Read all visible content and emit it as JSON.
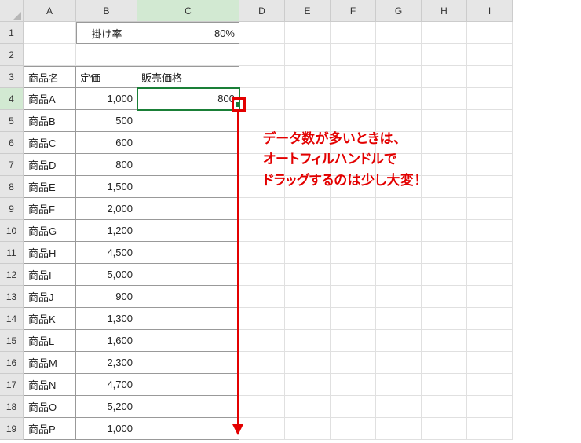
{
  "columns": [
    "A",
    "B",
    "C",
    "D",
    "E",
    "F",
    "G",
    "H",
    "I"
  ],
  "row_count": 19,
  "b1": {
    "label": "掛け率"
  },
  "c1": {
    "value": "80%"
  },
  "headers": {
    "a3": "商品名",
    "b3": "定価",
    "c3": "販売価格"
  },
  "products": [
    {
      "name": "商品A",
      "price": "1,000",
      "sale": "800"
    },
    {
      "name": "商品B",
      "price": "500",
      "sale": ""
    },
    {
      "name": "商品C",
      "price": "600",
      "sale": ""
    },
    {
      "name": "商品D",
      "price": "800",
      "sale": ""
    },
    {
      "name": "商品E",
      "price": "1,500",
      "sale": ""
    },
    {
      "name": "商品F",
      "price": "2,000",
      "sale": ""
    },
    {
      "name": "商品G",
      "price": "1,200",
      "sale": ""
    },
    {
      "name": "商品H",
      "price": "4,500",
      "sale": ""
    },
    {
      "name": "商品I",
      "price": "5,000",
      "sale": ""
    },
    {
      "name": "商品J",
      "price": "900",
      "sale": ""
    },
    {
      "name": "商品K",
      "price": "1,300",
      "sale": ""
    },
    {
      "name": "商品L",
      "price": "1,600",
      "sale": ""
    },
    {
      "name": "商品M",
      "price": "2,300",
      "sale": ""
    },
    {
      "name": "商品N",
      "price": "4,700",
      "sale": ""
    },
    {
      "name": "商品O",
      "price": "5,200",
      "sale": ""
    },
    {
      "name": "商品P",
      "price": "1,000",
      "sale": ""
    }
  ],
  "annotation": {
    "line1": "データ数が多いときは、",
    "line2": "オートフィルハンドルで",
    "line3": "ドラッグするのは少し大変！"
  },
  "active_cell": "C4",
  "selected_col": "C",
  "selected_row": 4,
  "colors": {
    "accent": "#1a7f37",
    "highlight": "#e30000"
  }
}
